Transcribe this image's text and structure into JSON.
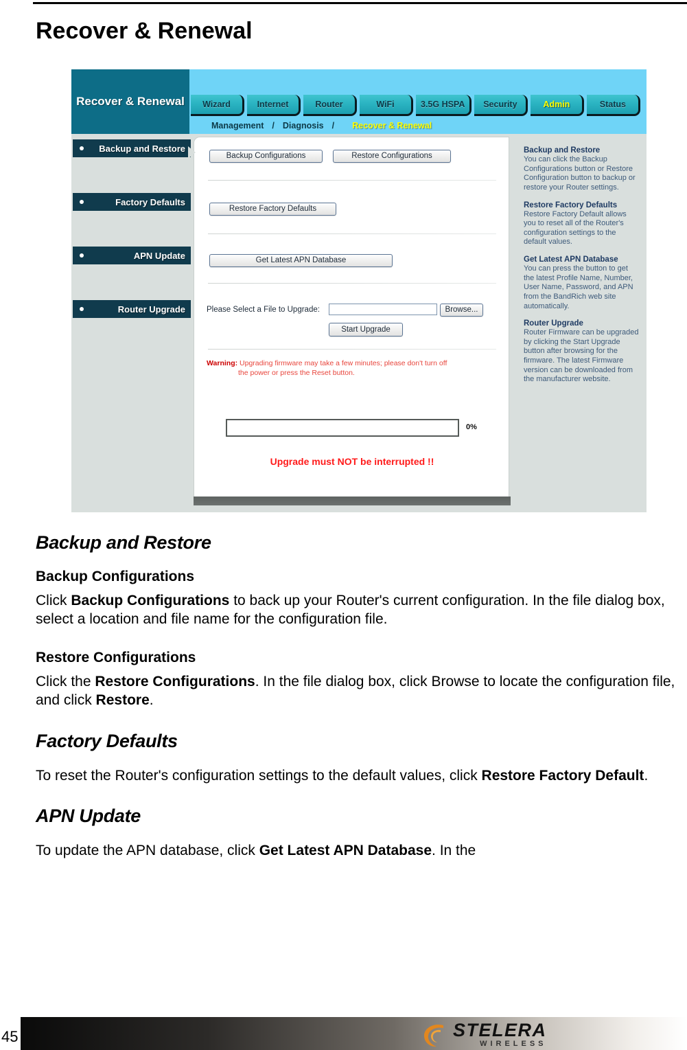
{
  "document": {
    "page_title": "Recover & Renewal",
    "page_number": "45",
    "sections": [
      {
        "heading": "Backup and Restore",
        "subsections": [
          {
            "heading": "Backup Configurations",
            "body_pre": "Click ",
            "body_bold": "Backup Configurations",
            "body_post": " to back up your Router's current configuration. In the file dialog box, select a location and file name for the configuration file."
          },
          {
            "heading": "Restore Configurations",
            "body_pre": "Click the ",
            "body_bold": "Restore Configurations",
            "body_mid": ". In the file dialog box, click Browse to locate the configuration file, and click ",
            "body_bold2": "Restore",
            "body_post": "."
          }
        ]
      },
      {
        "heading": "Factory Defaults",
        "body_pre": "To reset the Router's configuration settings to the default values, click ",
        "body_bold": "Restore Factory Default",
        "body_post": "."
      },
      {
        "heading": "APN Update",
        "body_pre": "To update the APN database, click ",
        "body_bold": "Get Latest APN Database",
        "body_post": ". In the"
      }
    ]
  },
  "router_ui": {
    "brand_title": "Recover & Renewal",
    "tabs": [
      {
        "label": "Wizard",
        "active": false
      },
      {
        "label": "Internet",
        "active": false
      },
      {
        "label": "Router",
        "active": false
      },
      {
        "label": "WiFi",
        "active": false
      },
      {
        "label": "3.5G HSPA",
        "active": false
      },
      {
        "label": "Security",
        "active": false
      },
      {
        "label": "Admin",
        "active": true
      },
      {
        "label": "Status",
        "active": false
      }
    ],
    "breadcrumb": {
      "item1": "Management",
      "sep1": "/",
      "item2": "Diagnosis",
      "sep2": "/",
      "current": "Recover & Renewal"
    },
    "sidebar": {
      "items": [
        {
          "label": "Backup and Restore"
        },
        {
          "label": "Factory Defaults"
        },
        {
          "label": "APN Update"
        },
        {
          "label": "Router Upgrade"
        }
      ]
    },
    "main": {
      "backup_button": "Backup Configurations",
      "restore_button": "Restore Configurations",
      "restore_factory_button": "Restore Factory Defaults",
      "get_apn_button": "Get Latest APN Database",
      "file_label": "Please Select a File to Upgrade:",
      "file_value": "",
      "browse_button": "Browse...",
      "start_upgrade_button": "Start Upgrade",
      "warning_label": "Warning:",
      "warning_line1": "Upgrading firmware may take a few minutes; please don't turn off",
      "warning_line2": "the power or press the Reset button.",
      "progress_percent": "0%",
      "progress_value": 0,
      "big_warning": "Upgrade must NOT be interrupted !!"
    },
    "help": {
      "blocks": [
        {
          "heading": "Backup and Restore",
          "text": "You can click the Backup Configurations button or Restore Configuration button to backup or restore your Router settings."
        },
        {
          "heading": "Restore Factory Defaults",
          "text": "Restore Factory Default allows you to reset all of the Router's configuration settings to the default values."
        },
        {
          "heading": "Get Latest APN Database",
          "text": "You can press the button to get the latest Profile Name, Number, User Name, Password, and APN from the BandRich web site automatically."
        },
        {
          "heading": "Router Upgrade",
          "text": "Router Firmware can be upgraded by clicking the Start Upgrade button after browsing for the firmware. The latest Firmware version can be downloaded from the manufacturer website."
        }
      ]
    }
  },
  "footer": {
    "logo_word": "STELERA",
    "logo_sub": "WIRELESS"
  },
  "colors": {
    "brand_teal": "#0d6d87",
    "nav_blue": "#6fd4f7",
    "tab_teal": "#2bb4c2",
    "active_tab_text": "#ffff00",
    "sidebar_navy": "#103b4d",
    "panel_gray": "#d9dfdd",
    "warning_red": "#e8453c",
    "big_warning_red": "#ff1a1a",
    "help_heading": "#1f3b63",
    "help_text": "#3d5a7a"
  }
}
